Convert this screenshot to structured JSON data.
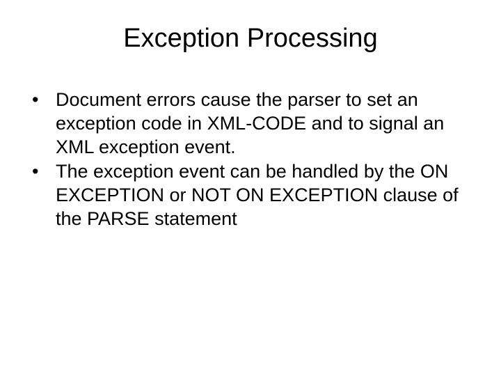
{
  "title": "Exception Processing",
  "bullets": [
    "Document errors cause the parser to set an exception code in XML-CODE and to signal an XML exception event.",
    "The exception event can be handled by the ON EXCEPTION or NOT ON EXCEPTION clause of the PARSE statement"
  ]
}
